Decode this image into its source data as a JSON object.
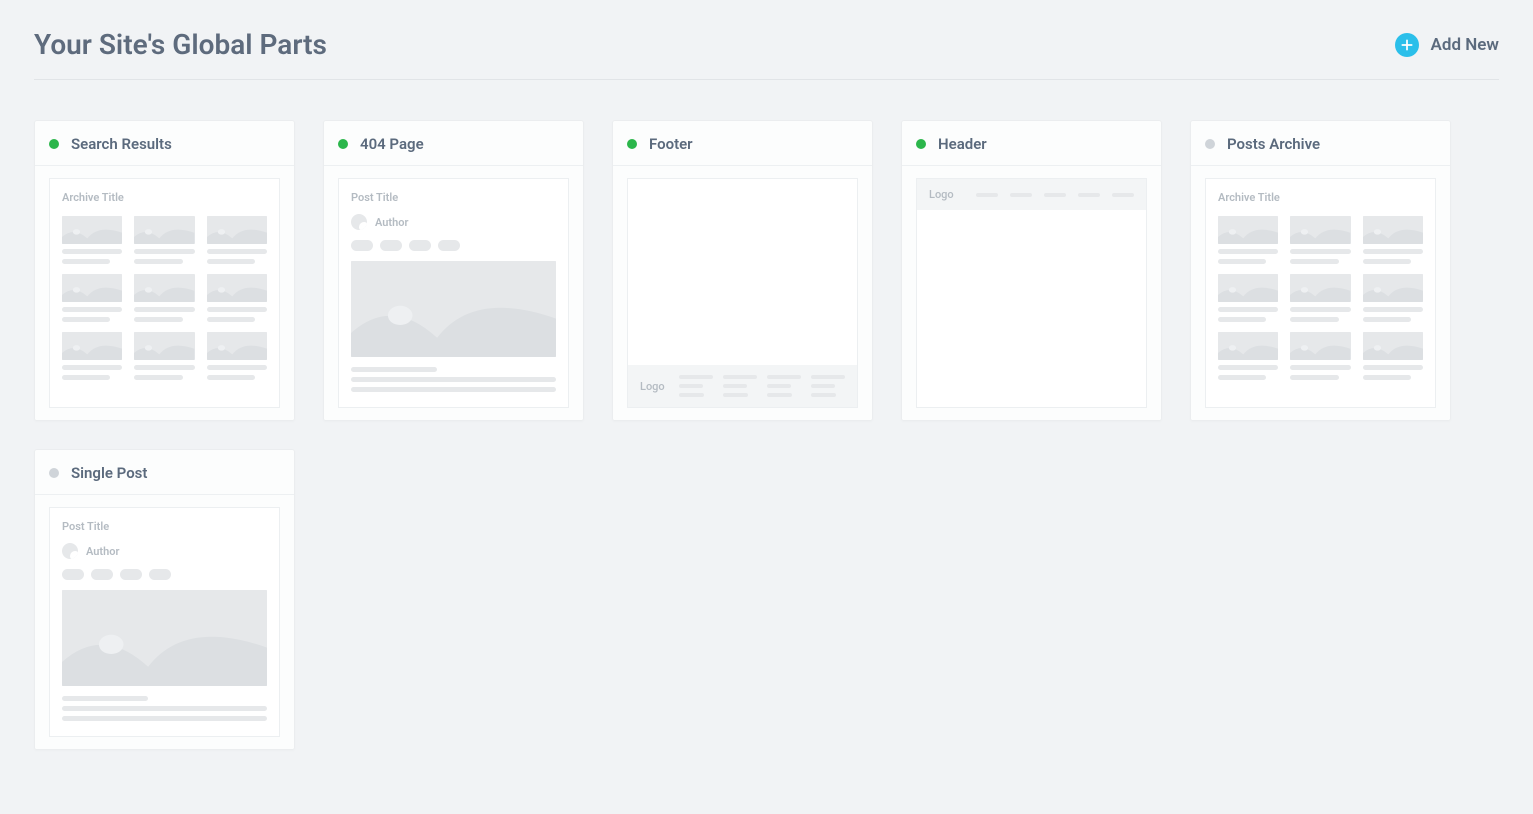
{
  "page": {
    "title": "Your Site's Global Parts",
    "add_label": "Add New"
  },
  "preview_labels": {
    "archive_title": "Archive Title",
    "post_title": "Post Title",
    "author": "Author",
    "logo": "Logo"
  },
  "cards": [
    {
      "name": "Search Results",
      "active": true,
      "preview": "archive"
    },
    {
      "name": "404 Page",
      "active": true,
      "preview": "post"
    },
    {
      "name": "Footer",
      "active": true,
      "preview": "footer"
    },
    {
      "name": "Header",
      "active": true,
      "preview": "header"
    },
    {
      "name": "Posts Archive",
      "active": false,
      "preview": "archive"
    },
    {
      "name": "Single Post",
      "active": false,
      "preview": "post"
    }
  ],
  "colors": {
    "active_dot": "#2bb64b",
    "inactive_dot": "#cfd4d9",
    "accent": "#2bbfea"
  }
}
